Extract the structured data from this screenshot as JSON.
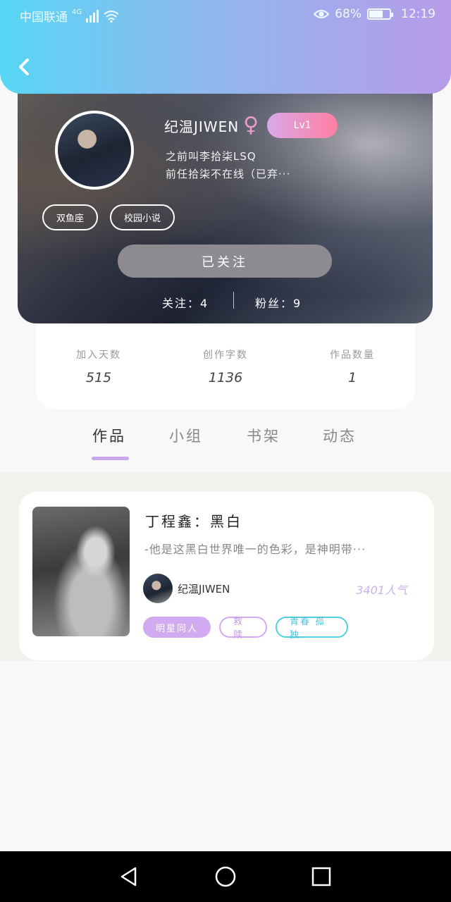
{
  "status_bar": {
    "carrier": "中国联通",
    "network": "4G",
    "battery": "68%",
    "battery_level": 0.68,
    "time": "12:19"
  },
  "profile": {
    "name": "纪温JIWEN",
    "gender_symbol": "♀",
    "level": "Lv1",
    "bio_line1": "之前叫李拾柒LSQ",
    "bio_line2": "前任拾柒不在线（已弃···",
    "tags": [
      "双鱼座",
      "校园小说"
    ],
    "follow_label": "已关注",
    "following": "关注：4",
    "fans": "粉丝：9"
  },
  "stats": [
    {
      "label": "加入天数",
      "value": "515"
    },
    {
      "label": "创作字数",
      "value": "1136"
    },
    {
      "label": "作品数量",
      "value": "1"
    }
  ],
  "tabs": [
    "作品",
    "小组",
    "书架",
    "动态"
  ],
  "active_tab": "作品",
  "work": {
    "title": "丁程鑫：黑白",
    "description": "-他是这黑白世界唯一的色彩，是神明带···",
    "author": "纪温JIWEN",
    "popularity": "3401人气",
    "tags": [
      "明星同人",
      "救赎",
      "青春  孤独"
    ]
  },
  "colors": {
    "header_gradient_start": "#57d6f5",
    "header_gradient_end": "#b89be8",
    "accent_purple": "#d2aaf0",
    "accent_cyan": "#4fd0e3",
    "level_badge_start": "#d9a8e8",
    "level_badge_end": "#ff7fa2"
  },
  "icons": {
    "back": "chevron-left-icon",
    "nav_back": "triangle-back-icon",
    "nav_home": "circle-home-icon",
    "nav_recent": "square-recent-icon"
  }
}
